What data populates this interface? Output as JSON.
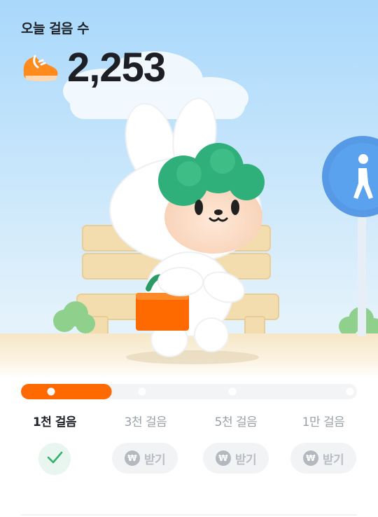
{
  "header": {
    "label": "오늘 걸음 수",
    "steps": "2,253",
    "shoe_icon": "sneaker-icon"
  },
  "scene": {
    "character": "bunny-character",
    "sign_icon": "pedestrian-sign-icon"
  },
  "progress": {
    "fraction": 0.27,
    "fill_color": "#ff6a00",
    "track_color": "#f3f4f6"
  },
  "milestones": [
    {
      "label": "1천 걸음",
      "status": "done"
    },
    {
      "label": "3천 걸음",
      "status": "locked",
      "button_label": "받기"
    },
    {
      "label": "5천 걸음",
      "status": "locked",
      "button_label": "받기"
    },
    {
      "label": "1만 걸음",
      "status": "locked",
      "button_label": "받기"
    }
  ],
  "won_symbol": "₩",
  "colors": {
    "accent": "#ff6a00",
    "check": "#2fb36b"
  }
}
